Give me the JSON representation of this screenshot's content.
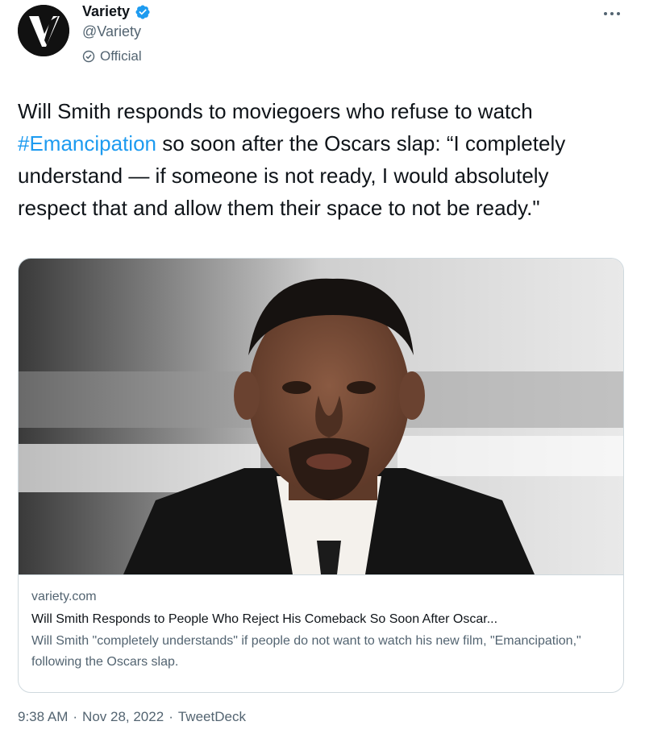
{
  "author": {
    "display_name": "Variety",
    "handle": "@Variety",
    "label": "Official",
    "avatar_icon": "variety-v-logo",
    "verified_icon": "verified-badge-icon",
    "label_icon": "official-check-icon"
  },
  "menu_icon": "more-horizontal-icon",
  "tweet": {
    "text_before": "Will Smith responds to moviegoers who refuse to watch ",
    "hashtag": "#Emancipation",
    "text_after": " so soon after the Oscars slap: “I completely understand — if someone is not ready, I would absolutely respect that and allow them their space to not be ready.\""
  },
  "card": {
    "domain": "variety.com",
    "title": "Will Smith Responds to People Who Reject His Comeback So Soon After Oscar...",
    "description": "Will Smith \"completely understands\" if people do not want to watch his new film, \"Emancipation,\" following the Oscars slap."
  },
  "meta": {
    "time": "9:38 AM",
    "separator": "·",
    "date": "Nov 28, 2022",
    "source": "TweetDeck"
  },
  "colors": {
    "accent": "#1d9bf0",
    "secondary_text": "#536471",
    "primary_text": "#0f1419",
    "border": "#cfd9de"
  }
}
